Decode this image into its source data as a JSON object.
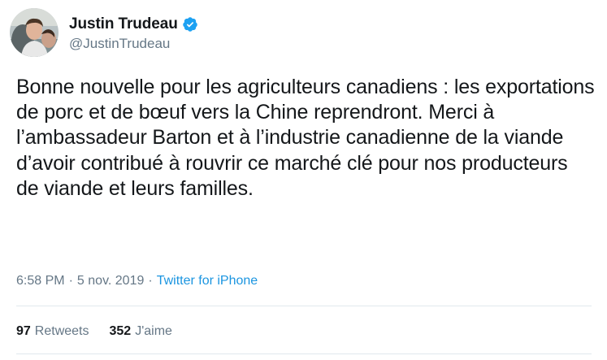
{
  "author": {
    "display_name": "Justin Trudeau",
    "handle": "@JustinTrudeau",
    "verified_icon": "verified-badge-icon",
    "verified_color": "#1da1f2"
  },
  "tweet": {
    "text": "Bonne nouvelle pour les agriculteurs canadiens : les exportations de porc et de bœuf vers la Chine reprendront. Merci à l’ambassadeur Barton et à l’industrie canadienne de la viande d’avoir contribué à rouvrir ce marché clé pour nos producteurs de viande et leurs familles."
  },
  "meta": {
    "time": "6:58 PM",
    "separator": "·",
    "date": "5 nov. 2019",
    "source": "Twitter for iPhone",
    "source_color": "#1b95e0"
  },
  "stats": {
    "retweets_count": "97",
    "retweets_label": "Retweets",
    "likes_count": "352",
    "likes_label": "J'aime"
  }
}
